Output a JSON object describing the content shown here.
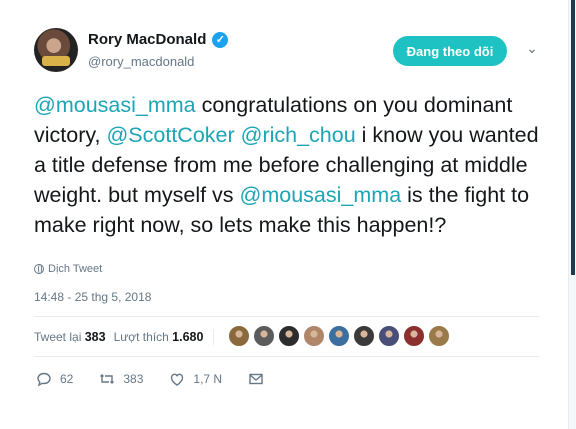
{
  "user": {
    "name": "Rory MacDonald",
    "handle": "@rory_macdonald"
  },
  "follow_label": "Đang theo dõi",
  "tweet": {
    "segments": [
      {
        "text": "@mousasi_mma",
        "mention": true
      },
      {
        "text": " congratulations on you dominant victory, ",
        "mention": false
      },
      {
        "text": "@ScottCoker",
        "mention": true
      },
      {
        "text": " ",
        "mention": false
      },
      {
        "text": "@rich_chou",
        "mention": true
      },
      {
        "text": " i know you wanted a title defense from me before challenging at middle weight. but myself vs ",
        "mention": false
      },
      {
        "text": "@mousasi_mma",
        "mention": true
      },
      {
        "text": " is the fight to make right now, so lets make this happen!?",
        "mention": false
      }
    ]
  },
  "translate_label": "Dịch Tweet",
  "timestamp": "14:48 - 25 thg 5, 2018",
  "stats": {
    "retweets_label": "Tweet lại",
    "retweets": "383",
    "likes_label": "Lượt thích",
    "likes": "1.680"
  },
  "liker_colors": [
    "#8a6a3c",
    "#5c5c5c",
    "#2d2d2d",
    "#b0866a",
    "#3b6fa0",
    "#3a3a3a",
    "#4a4f7a",
    "#8c2f2f",
    "#9a7a4a"
  ],
  "actions": {
    "reply_count": "62",
    "retweet_count": "383",
    "like_count": "1,7 N"
  },
  "colors": {
    "accent": "#1ec2c2",
    "mention": "#1ca5b5",
    "verified": "#1da1f2"
  }
}
